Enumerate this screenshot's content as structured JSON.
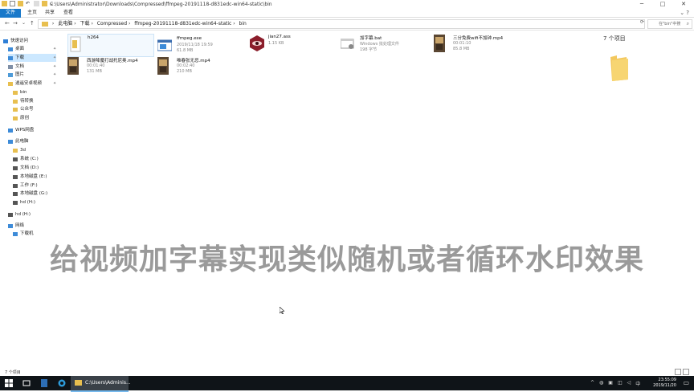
{
  "window": {
    "title_path": "C:\\Users\\Administrator\\Downloads\\Compressed\\ffmpeg-20191118-d831edc-win64-static\\bin",
    "controls": [
      "─",
      "□",
      "✕"
    ]
  },
  "ribbon": {
    "tabs": [
      "文件",
      "主页",
      "共享",
      "查看"
    ],
    "right": "⌄ ?"
  },
  "nav": {
    "breadcrumbs": [
      "此电脑",
      "下载",
      "Compressed",
      "ffmpeg-20191118-d831edc-win64-static",
      "bin"
    ],
    "search_placeholder": "在\"bin\"中搜"
  },
  "sidebar": {
    "items": [
      {
        "label": "快速访问",
        "icon": "star-icon",
        "color": "#2f7fd6"
      },
      {
        "label": "桌面",
        "icon": "desktop-icon",
        "color": "#3d8bd8",
        "pinned": true
      },
      {
        "label": "下载",
        "icon": "download-icon",
        "color": "#3d8bd8",
        "pinned": true,
        "selected": true
      },
      {
        "label": "文档",
        "icon": "document-icon",
        "color": "#7f8fa6",
        "pinned": true
      },
      {
        "label": "图片",
        "icon": "picture-icon",
        "color": "#4e9bd8",
        "pinned": true
      },
      {
        "label": "逍遥安卓视频",
        "icon": "folder-icon",
        "color": "#e8bf4f",
        "pinned": true
      },
      {
        "label": "bin",
        "icon": "folder-icon",
        "color": "#e8bf4f"
      },
      {
        "label": "待转换",
        "icon": "folder-icon",
        "color": "#e8bf4f"
      },
      {
        "label": "公众号",
        "icon": "folder-icon",
        "color": "#e8bf4f"
      },
      {
        "label": "原创",
        "icon": "folder-icon",
        "color": "#e8bf4f"
      },
      {
        "label": "WPS网盘",
        "icon": "cloud-icon",
        "color": "#3d8bd8"
      },
      {
        "label": "此电脑",
        "icon": "computer-icon",
        "color": "#3d8bd8"
      },
      {
        "label": "3d",
        "icon": "folder-icon",
        "color": "#e8bf4f"
      },
      {
        "label": "系统 (C:)",
        "icon": "drive-icon",
        "color": "#555555"
      },
      {
        "label": "文档 (D:)",
        "icon": "drive-icon",
        "color": "#555555"
      },
      {
        "label": "本地磁盘 (E:)",
        "icon": "drive-icon",
        "color": "#555555"
      },
      {
        "label": "工作 (F:)",
        "icon": "drive-icon",
        "color": "#555555"
      },
      {
        "label": "本地磁盘 (G:)",
        "icon": "drive-icon",
        "color": "#555555"
      },
      {
        "label": "hd (H:)",
        "icon": "drive-icon",
        "color": "#555555"
      },
      {
        "label": "hd (H:)",
        "icon": "drive-icon",
        "color": "#555555"
      },
      {
        "label": "网络",
        "icon": "network-icon",
        "color": "#3d8bd8"
      },
      {
        "label": "下载机",
        "icon": "computer-icon",
        "color": "#3d8bd8"
      }
    ]
  },
  "files": [
    {
      "name": "h264",
      "meta1": "",
      "meta2": "",
      "icon": "folder-file-icon",
      "kind": "folder"
    },
    {
      "name": "ffmpeg.exe",
      "meta1": "2019/11/18 19:59",
      "meta2": "61.8 MB",
      "icon": "exe-icon",
      "kind": "exe"
    },
    {
      "name": "jian27.ass",
      "meta1": "1.15 KB",
      "meta2": "",
      "icon": "ass-icon",
      "kind": "ass"
    },
    {
      "name": "加字幕.bat",
      "meta1": "Windows 批处理文件",
      "meta2": "198 字节",
      "icon": "bat-icon",
      "kind": "bat"
    },
    {
      "name": "三分免费wifi不加钟.mp4",
      "meta1": "00:01:10",
      "meta2": "85.8 MB",
      "icon": "video-icon",
      "kind": "video"
    },
    {
      "name": "西游降魔打战托尼奥.mp4",
      "meta1": "00:01:40",
      "meta2": "131 MB",
      "icon": "video-icon",
      "kind": "video"
    },
    {
      "name": "唯春张无忌.mp4",
      "meta1": "00:02:40",
      "meta2": "210 MB",
      "icon": "video-icon",
      "kind": "video"
    }
  ],
  "details_pane": {
    "text": "7 个项目"
  },
  "overlay": {
    "text": "给视频加字幕实现类似随机或者循环水印效果"
  },
  "status": {
    "count": "7 个项目"
  },
  "taskbar": {
    "active_label": "C:\\Users\\Adminis...",
    "time": "23:55:09",
    "date": "2019/11/20"
  }
}
